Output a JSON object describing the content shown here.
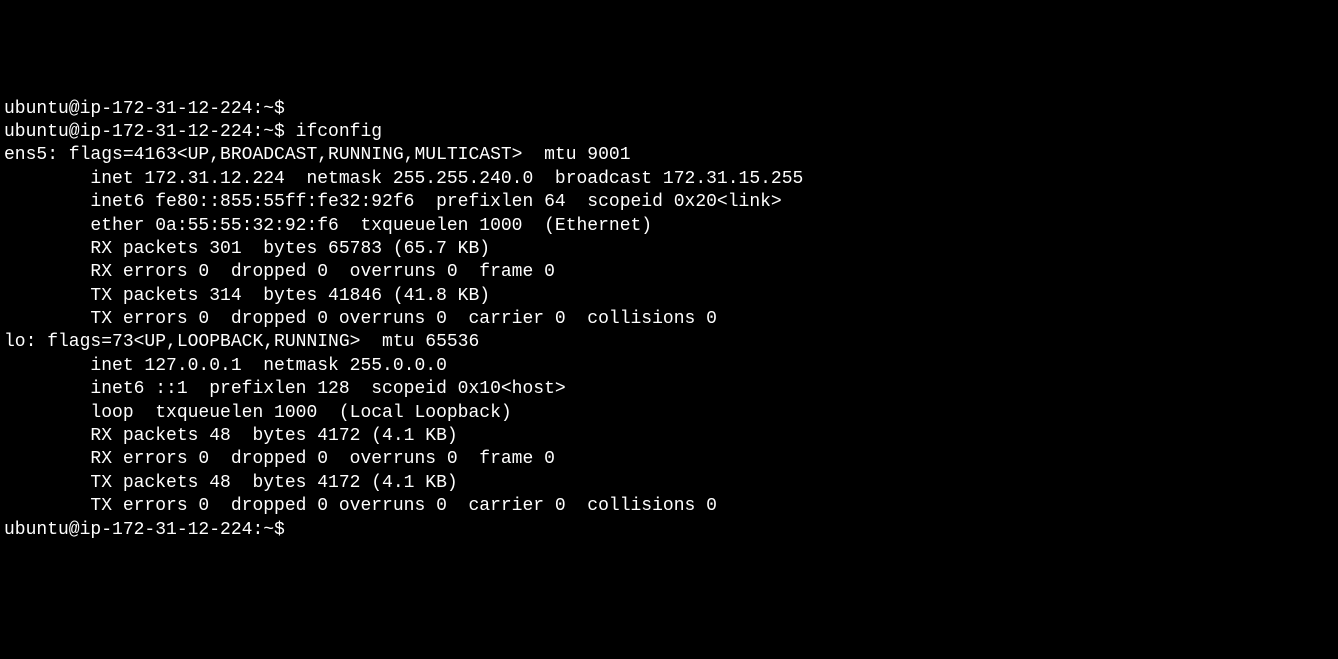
{
  "lines": [
    "ubuntu@ip-172-31-12-224:~$",
    "ubuntu@ip-172-31-12-224:~$ ifconfig",
    "ens5: flags=4163<UP,BROADCAST,RUNNING,MULTICAST>  mtu 9001",
    "        inet 172.31.12.224  netmask 255.255.240.0  broadcast 172.31.15.255",
    "        inet6 fe80::855:55ff:fe32:92f6  prefixlen 64  scopeid 0x20<link>",
    "        ether 0a:55:55:32:92:f6  txqueuelen 1000  (Ethernet)",
    "        RX packets 301  bytes 65783 (65.7 KB)",
    "        RX errors 0  dropped 0  overruns 0  frame 0",
    "        TX packets 314  bytes 41846 (41.8 KB)",
    "        TX errors 0  dropped 0 overruns 0  carrier 0  collisions 0",
    "",
    "lo: flags=73<UP,LOOPBACK,RUNNING>  mtu 65536",
    "        inet 127.0.0.1  netmask 255.0.0.0",
    "        inet6 ::1  prefixlen 128  scopeid 0x10<host>",
    "        loop  txqueuelen 1000  (Local Loopback)",
    "        RX packets 48  bytes 4172 (4.1 KB)",
    "        RX errors 0  dropped 0  overruns 0  frame 0",
    "        TX packets 48  bytes 4172 (4.1 KB)",
    "        TX errors 0  dropped 0 overruns 0  carrier 0  collisions 0",
    "",
    "ubuntu@ip-172-31-12-224:~$"
  ]
}
